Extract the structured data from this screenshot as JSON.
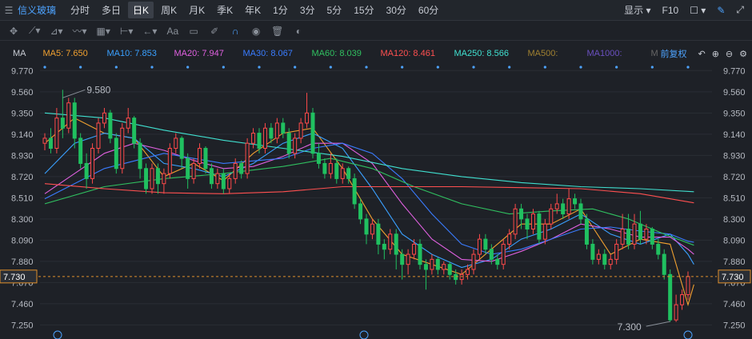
{
  "topbar": {
    "stock_name": "信义玻璃",
    "timeframes": [
      "分时",
      "多日",
      "日K",
      "周K",
      "月K",
      "季K",
      "年K",
      "1分",
      "3分",
      "5分",
      "15分",
      "30分",
      "60分"
    ],
    "active_timeframe": "日K",
    "display_label": "显示",
    "f10_label": "F10"
  },
  "ma_bar": {
    "label": "MA",
    "items": [
      {
        "text": "MA5: 7.650",
        "color": "#f0a030"
      },
      {
        "text": "MA10: 7.853",
        "color": "#3aa0ff"
      },
      {
        "text": "MA20: 7.947",
        "color": "#e060e0"
      },
      {
        "text": "MA30: 8.067",
        "color": "#3a7cff"
      },
      {
        "text": "MA60: 8.039",
        "color": "#30c060"
      },
      {
        "text": "MA120: 8.461",
        "color": "#ff5050"
      },
      {
        "text": "MA250: 8.566",
        "color": "#40e0d0"
      },
      {
        "text": "MA500:",
        "color": "#a08030"
      },
      {
        "text": "MA1000:",
        "color": "#6a50c0"
      },
      {
        "text": "M",
        "color": "#666666"
      }
    ],
    "adjust_label": "前复权"
  },
  "chart_data": {
    "type": "candlestick",
    "y_ticks": [
      "9.770",
      "9.560",
      "9.350",
      "9.140",
      "8.930",
      "8.720",
      "8.510",
      "8.300",
      "8.090",
      "7.880",
      "7.670",
      "7.460",
      "7.250"
    ],
    "ylim": [
      7.19,
      9.82
    ],
    "last_price": "7.730",
    "annotations": [
      {
        "text": "9.580",
        "value": 9.58
      },
      {
        "text": "7.300",
        "value": 7.3
      }
    ],
    "up_color": "#ff4a4a",
    "down_color": "#20c060",
    "candles": [
      [
        9.05,
        9.1,
        8.98,
        9.15
      ],
      [
        9.1,
        9.0,
        8.95,
        9.2
      ],
      [
        9.0,
        9.3,
        8.95,
        9.4
      ],
      [
        9.3,
        9.2,
        9.1,
        9.58
      ],
      [
        9.2,
        9.45,
        9.15,
        9.5
      ],
      [
        9.45,
        9.1,
        9.0,
        9.5
      ],
      [
        9.1,
        8.85,
        8.8,
        9.15
      ],
      [
        8.85,
        8.7,
        8.6,
        8.95
      ],
      [
        8.7,
        9.0,
        8.65,
        9.05
      ],
      [
        9.0,
        9.25,
        8.95,
        9.3
      ],
      [
        9.25,
        9.35,
        9.2,
        9.4
      ],
      [
        9.35,
        9.1,
        9.05,
        9.38
      ],
      [
        9.1,
        8.8,
        8.75,
        9.15
      ],
      [
        8.8,
        9.2,
        8.75,
        9.25
      ],
      [
        9.2,
        9.3,
        9.15,
        9.4
      ],
      [
        9.3,
        9.05,
        9.0,
        9.32
      ],
      [
        9.05,
        8.8,
        8.7,
        9.1
      ],
      [
        8.8,
        8.6,
        8.55,
        8.85
      ],
      [
        8.6,
        8.8,
        8.55,
        8.85
      ],
      [
        8.8,
        8.65,
        8.55,
        8.85
      ],
      [
        8.65,
        8.75,
        8.55,
        8.8
      ],
      [
        8.75,
        9.0,
        8.7,
        9.05
      ],
      [
        9.0,
        9.1,
        8.95,
        9.15
      ],
      [
        9.1,
        8.9,
        8.8,
        9.12
      ],
      [
        8.9,
        8.7,
        8.6,
        8.95
      ],
      [
        8.7,
        8.85,
        8.65,
        8.9
      ],
      [
        8.85,
        9.0,
        8.8,
        9.05
      ],
      [
        9.0,
        8.8,
        8.75,
        9.02
      ],
      [
        8.8,
        8.65,
        8.6,
        8.85
      ],
      [
        8.65,
        8.75,
        8.6,
        8.8
      ],
      [
        8.75,
        8.6,
        8.55,
        8.8
      ],
      [
        8.6,
        8.7,
        8.55,
        8.75
      ],
      [
        8.7,
        8.85,
        8.65,
        8.9
      ],
      [
        8.85,
        8.75,
        8.7,
        8.88
      ],
      [
        8.75,
        9.05,
        8.7,
        9.1
      ],
      [
        9.05,
        9.15,
        9.0,
        9.2
      ],
      [
        9.15,
        9.0,
        8.95,
        9.2
      ],
      [
        9.0,
        9.2,
        8.95,
        9.25
      ],
      [
        9.2,
        9.1,
        9.05,
        9.25
      ],
      [
        9.1,
        9.25,
        9.05,
        9.3
      ],
      [
        9.25,
        9.15,
        9.1,
        9.3
      ],
      [
        9.15,
        8.95,
        8.9,
        9.2
      ],
      [
        8.95,
        9.1,
        8.9,
        9.15
      ],
      [
        9.1,
        9.25,
        9.05,
        9.3
      ],
      [
        9.25,
        9.35,
        9.2,
        9.55
      ],
      [
        9.35,
        8.95,
        8.9,
        9.4
      ],
      [
        8.95,
        8.85,
        8.8,
        9.05
      ],
      [
        8.85,
        8.75,
        8.7,
        8.9
      ],
      [
        8.75,
        8.85,
        8.7,
        8.95
      ],
      [
        8.85,
        8.7,
        8.65,
        8.9
      ],
      [
        8.7,
        8.8,
        8.65,
        8.85
      ],
      [
        8.8,
        8.7,
        8.65,
        8.82
      ],
      [
        8.7,
        8.45,
        8.4,
        8.75
      ],
      [
        8.45,
        8.3,
        8.25,
        8.5
      ],
      [
        8.3,
        8.15,
        8.05,
        8.35
      ],
      [
        8.15,
        8.25,
        8.1,
        8.3
      ],
      [
        8.25,
        8.05,
        7.95,
        8.3
      ],
      [
        8.05,
        8.0,
        7.9,
        8.1
      ],
      [
        8.0,
        8.15,
        7.95,
        8.2
      ],
      [
        8.15,
        7.95,
        7.8,
        8.2
      ],
      [
        7.95,
        7.85,
        7.7,
        8.0
      ],
      [
        7.85,
        7.95,
        7.75,
        8.0
      ],
      [
        7.95,
        8.05,
        7.9,
        8.1
      ],
      [
        8.05,
        7.85,
        7.8,
        8.1
      ],
      [
        7.85,
        7.8,
        7.6,
        7.9
      ],
      [
        7.8,
        7.9,
        7.75,
        7.95
      ],
      [
        7.9,
        7.8,
        7.75,
        7.92
      ],
      [
        7.8,
        7.85,
        7.75,
        7.88
      ],
      [
        7.85,
        7.75,
        7.7,
        7.88
      ],
      [
        7.75,
        7.7,
        7.65,
        7.8
      ],
      [
        7.7,
        7.75,
        7.65,
        7.8
      ],
      [
        7.75,
        7.8,
        7.7,
        7.85
      ],
      [
        7.8,
        7.95,
        7.75,
        8.0
      ],
      [
        7.95,
        8.1,
        7.9,
        8.15
      ],
      [
        8.1,
        8.0,
        7.95,
        8.15
      ],
      [
        8.0,
        7.9,
        7.85,
        8.05
      ],
      [
        7.9,
        7.85,
        7.8,
        7.95
      ],
      [
        7.85,
        8.05,
        7.8,
        8.1
      ],
      [
        8.05,
        8.15,
        8.0,
        8.2
      ],
      [
        8.15,
        8.4,
        8.1,
        8.45
      ],
      [
        8.4,
        8.3,
        8.2,
        8.45
      ],
      [
        8.3,
        8.2,
        8.1,
        8.35
      ],
      [
        8.2,
        8.35,
        8.15,
        8.4
      ],
      [
        8.35,
        8.1,
        8.05,
        8.38
      ],
      [
        8.1,
        8.25,
        8.05,
        8.3
      ],
      [
        8.25,
        8.4,
        8.2,
        8.45
      ],
      [
        8.4,
        8.45,
        8.35,
        8.55
      ],
      [
        8.45,
        8.35,
        8.3,
        8.5
      ],
      [
        8.35,
        8.5,
        8.3,
        8.6
      ],
      [
        8.5,
        8.45,
        8.4,
        8.55
      ],
      [
        8.45,
        8.3,
        8.25,
        8.5
      ],
      [
        8.3,
        8.05,
        8.0,
        8.35
      ],
      [
        8.05,
        7.9,
        7.85,
        8.1
      ],
      [
        7.9,
        7.95,
        7.85,
        8.0
      ],
      [
        7.95,
        7.85,
        7.8,
        8.0
      ],
      [
        7.85,
        7.9,
        7.8,
        7.95
      ],
      [
        7.9,
        8.05,
        7.85,
        8.1
      ],
      [
        8.05,
        8.2,
        8.0,
        8.35
      ],
      [
        8.2,
        8.05,
        8.0,
        8.35
      ],
      [
        8.05,
        8.25,
        8.0,
        8.35
      ],
      [
        8.25,
        8.1,
        8.05,
        8.38
      ],
      [
        8.1,
        8.2,
        8.05,
        8.25
      ],
      [
        8.2,
        8.05,
        8.0,
        8.22
      ],
      [
        8.05,
        7.95,
        7.9,
        8.1
      ],
      [
        7.95,
        7.75,
        7.7,
        8.0
      ],
      [
        7.75,
        7.3,
        7.28,
        7.8
      ],
      [
        7.3,
        7.45,
        7.28,
        7.55
      ],
      [
        7.45,
        7.55,
        7.4,
        7.6
      ],
      [
        7.55,
        7.73,
        7.5,
        7.78
      ]
    ],
    "ma_series": [
      {
        "name": "MA5",
        "color": "#f0a030",
        "values": [
          [
            0,
            9.05
          ],
          [
            5,
            9.3
          ],
          [
            10,
            9.15
          ],
          [
            15,
            9.1
          ],
          [
            20,
            8.72
          ],
          [
            25,
            8.85
          ],
          [
            30,
            8.68
          ],
          [
            35,
            8.95
          ],
          [
            40,
            9.15
          ],
          [
            45,
            9.2
          ],
          [
            50,
            8.8
          ],
          [
            55,
            8.3
          ],
          [
            60,
            7.95
          ],
          [
            65,
            7.85
          ],
          [
            70,
            7.75
          ],
          [
            75,
            8.0
          ],
          [
            80,
            8.25
          ],
          [
            85,
            8.25
          ],
          [
            90,
            8.4
          ],
          [
            95,
            7.95
          ],
          [
            100,
            8.1
          ],
          [
            105,
            8.05
          ],
          [
            108,
            7.45
          ],
          [
            109,
            7.65
          ]
        ]
      },
      {
        "name": "MA10",
        "color": "#3aa0ff",
        "values": [
          [
            0,
            8.75
          ],
          [
            5,
            9.05
          ],
          [
            10,
            9.15
          ],
          [
            15,
            9.1
          ],
          [
            20,
            8.85
          ],
          [
            25,
            8.8
          ],
          [
            30,
            8.72
          ],
          [
            35,
            8.85
          ],
          [
            40,
            9.05
          ],
          [
            45,
            9.15
          ],
          [
            50,
            9.0
          ],
          [
            55,
            8.6
          ],
          [
            60,
            8.15
          ],
          [
            65,
            7.95
          ],
          [
            70,
            7.82
          ],
          [
            75,
            7.9
          ],
          [
            80,
            8.1
          ],
          [
            85,
            8.2
          ],
          [
            90,
            8.35
          ],
          [
            95,
            8.15
          ],
          [
            100,
            8.05
          ],
          [
            105,
            8.15
          ],
          [
            108,
            7.95
          ],
          [
            109,
            7.85
          ]
        ]
      },
      {
        "name": "MA20",
        "color": "#e060e0",
        "values": [
          [
            0,
            8.55
          ],
          [
            5,
            8.75
          ],
          [
            10,
            8.95
          ],
          [
            15,
            9.05
          ],
          [
            20,
            8.98
          ],
          [
            25,
            8.88
          ],
          [
            30,
            8.8
          ],
          [
            35,
            8.82
          ],
          [
            40,
            8.92
          ],
          [
            45,
            9.05
          ],
          [
            50,
            9.05
          ],
          [
            55,
            8.85
          ],
          [
            60,
            8.45
          ],
          [
            65,
            8.1
          ],
          [
            70,
            7.9
          ],
          [
            75,
            7.88
          ],
          [
            80,
            7.98
          ],
          [
            85,
            8.1
          ],
          [
            90,
            8.25
          ],
          [
            95,
            8.2
          ],
          [
            100,
            8.12
          ],
          [
            105,
            8.12
          ],
          [
            108,
            8.0
          ],
          [
            109,
            7.95
          ]
        ]
      },
      {
        "name": "MA30",
        "color": "#3a7cff",
        "values": [
          [
            0,
            8.5
          ],
          [
            10,
            8.8
          ],
          [
            20,
            8.95
          ],
          [
            30,
            8.85
          ],
          [
            40,
            8.9
          ],
          [
            45,
            9.0
          ],
          [
            50,
            9.05
          ],
          [
            55,
            8.95
          ],
          [
            60,
            8.7
          ],
          [
            65,
            8.35
          ],
          [
            70,
            8.05
          ],
          [
            75,
            7.95
          ],
          [
            80,
            8.0
          ],
          [
            85,
            8.1
          ],
          [
            90,
            8.2
          ],
          [
            95,
            8.22
          ],
          [
            100,
            8.18
          ],
          [
            105,
            8.15
          ],
          [
            108,
            8.08
          ],
          [
            109,
            8.07
          ]
        ]
      },
      {
        "name": "MA60",
        "color": "#30c060",
        "values": [
          [
            0,
            8.45
          ],
          [
            10,
            8.62
          ],
          [
            20,
            8.7
          ],
          [
            30,
            8.75
          ],
          [
            40,
            8.82
          ],
          [
            48,
            8.9
          ],
          [
            55,
            8.8
          ],
          [
            62,
            8.62
          ],
          [
            70,
            8.45
          ],
          [
            78,
            8.35
          ],
          [
            85,
            8.38
          ],
          [
            92,
            8.4
          ],
          [
            98,
            8.3
          ],
          [
            104,
            8.15
          ],
          [
            109,
            8.04
          ]
        ]
      },
      {
        "name": "MA120",
        "color": "#ff5050",
        "values": [
          [
            0,
            8.65
          ],
          [
            10,
            8.6
          ],
          [
            20,
            8.56
          ],
          [
            30,
            8.55
          ],
          [
            40,
            8.57
          ],
          [
            50,
            8.62
          ],
          [
            60,
            8.62
          ],
          [
            70,
            8.62
          ],
          [
            80,
            8.61
          ],
          [
            90,
            8.6
          ],
          [
            100,
            8.55
          ],
          [
            109,
            8.46
          ]
        ]
      },
      {
        "name": "MA250",
        "color": "#40e0d0",
        "values": [
          [
            0,
            9.35
          ],
          [
            10,
            9.3
          ],
          [
            20,
            9.18
          ],
          [
            30,
            9.08
          ],
          [
            40,
            9.0
          ],
          [
            50,
            8.92
          ],
          [
            60,
            8.8
          ],
          [
            70,
            8.72
          ],
          [
            80,
            8.66
          ],
          [
            90,
            8.62
          ],
          [
            100,
            8.6
          ],
          [
            109,
            8.57
          ]
        ]
      }
    ]
  }
}
